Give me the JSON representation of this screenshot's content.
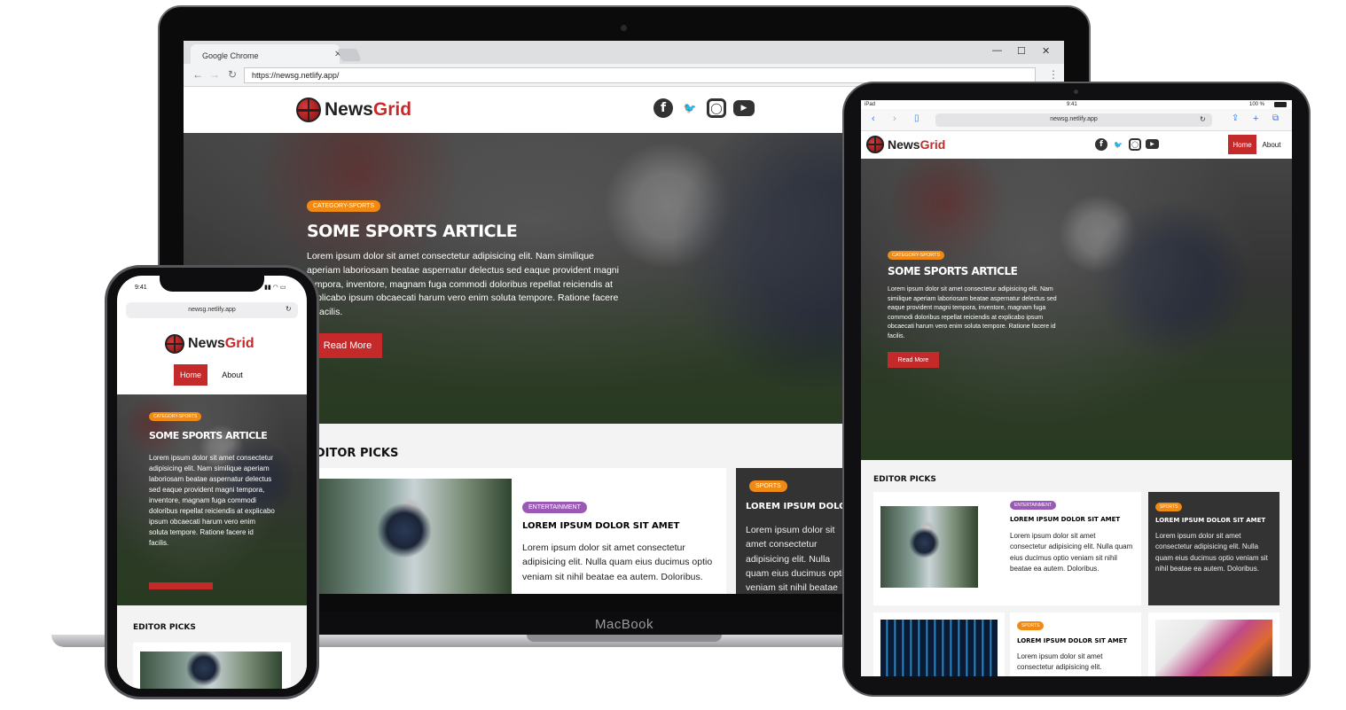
{
  "laptop": {
    "brand": "MacBook",
    "chrome": {
      "tab_title": "Google Chrome",
      "url": "https://newsg.netlify.app/"
    }
  },
  "site": {
    "logo_news": "News",
    "logo_grid": "Grid",
    "nav": {
      "home": "Home",
      "about": "About"
    },
    "social_icons": [
      "facebook-icon",
      "twitter-icon",
      "instagram-icon",
      "youtube-icon"
    ],
    "hero": {
      "category": "CATEGORY-SPORTS",
      "title": "SOME SPORTS ARTICLE",
      "text": "Lorem ipsum dolor sit amet consectetur adipisicing elit. Nam similique aperiam laboriosam beatae aspernatur delectus sed eaque provident magni tempora, inventore, magnam fuga commodi doloribus repellat reiciendis at explicabo ipsum obcaecati harum vero enim soluta tempore. Ratione facere id facilis.",
      "button": "Read More"
    },
    "editor_picks": {
      "title": "EDITOR PICKS",
      "cards": [
        {
          "category": "ENTERTAINMENT",
          "title": "LOREM IPSUM DOLOR SIT AMET",
          "text": "Lorem ipsum dolor sit amet consectetur adipisicing elit. Nulla quam eius ducimus optio veniam sit nihil beatae ea autem. Doloribus."
        },
        {
          "category": "SPORTS",
          "title": "LOREM IPSUM DOLOR SIT AMET",
          "text": "Lorem ipsum dolor sit amet consectetur adipisicing elit. Nulla quam eius ducimus optio veniam sit nihil beatae ea autem. Doloribus."
        },
        {
          "category": "SPORTS",
          "title": "LOREM IPSUM DOLOR SIT AMET",
          "text": "Lorem ipsum dolor sit amet consectetur adipisicing elit."
        }
      ]
    }
  },
  "tablet": {
    "status_left": "iPad",
    "status_time": "9:41",
    "status_battery": "100 %",
    "url": "newsg.netlify.app"
  },
  "phone": {
    "status_time": "9:41",
    "url": "newsg.netlify.app"
  },
  "colors": {
    "brand_red": "#c52a2a",
    "sports_orange": "#f08a14",
    "entertainment_purple": "#9b59b6",
    "dark_card": "#333333"
  }
}
